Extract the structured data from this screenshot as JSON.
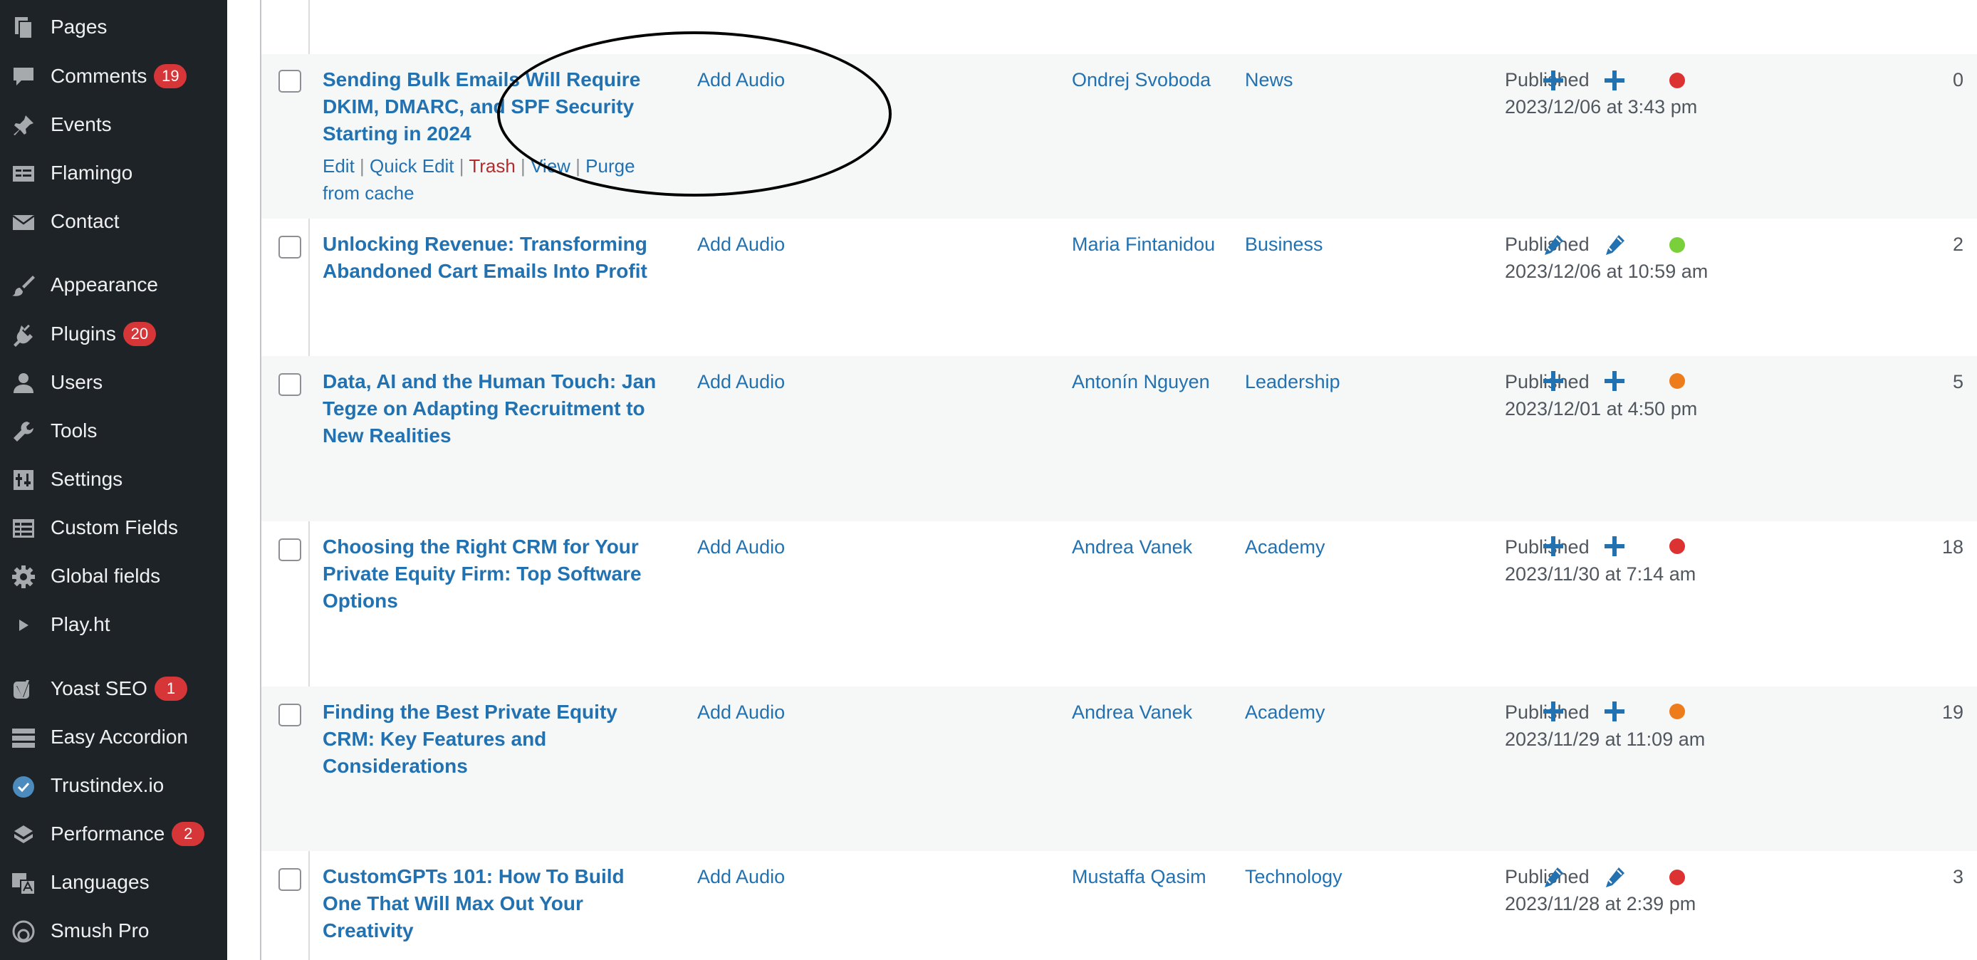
{
  "sidebar": {
    "items": [
      {
        "label": "Pages",
        "icon": "pages-icon",
        "badge": ""
      },
      {
        "label": "Comments",
        "icon": "comments-icon",
        "badge": "19"
      },
      {
        "label": "Events",
        "icon": "events-pin-icon",
        "badge": ""
      },
      {
        "label": "Flamingo",
        "icon": "flamingo-icon",
        "badge": ""
      },
      {
        "label": "Contact",
        "icon": "envelope-icon",
        "badge": ""
      },
      {
        "label": "Appearance",
        "icon": "paintbrush-icon",
        "badge": ""
      },
      {
        "label": "Plugins",
        "icon": "plugin-icon",
        "badge": "20"
      },
      {
        "label": "Users",
        "icon": "users-icon",
        "badge": ""
      },
      {
        "label": "Tools",
        "icon": "wrench-icon",
        "badge": ""
      },
      {
        "label": "Settings",
        "icon": "settings-icon",
        "badge": ""
      },
      {
        "label": "Custom Fields",
        "icon": "custom-fields-icon",
        "badge": ""
      },
      {
        "label": "Global fields",
        "icon": "gear-icon",
        "badge": ""
      },
      {
        "label": "Play.ht",
        "icon": "play-icon",
        "badge": ""
      },
      {
        "label": "Yoast SEO",
        "icon": "yoast-icon",
        "badge": "1"
      },
      {
        "label": "Easy Accordion",
        "icon": "accordion-icon",
        "badge": ""
      },
      {
        "label": "Trustindex.io",
        "icon": "trustindex-check-icon",
        "badge": ""
      },
      {
        "label": "Performance",
        "icon": "performance-icon",
        "badge": "2"
      },
      {
        "label": "Languages",
        "icon": "languages-icon",
        "badge": ""
      },
      {
        "label": "Smush Pro",
        "icon": "smush-icon",
        "badge": ""
      }
    ]
  },
  "posts": {
    "rows": [
      {
        "title": "Sending Bulk Emails Will Require DKIM, DMARC, and SPF Security Starting in 2024",
        "audio": "Add Audio",
        "author": "Ondrej Svoboda",
        "category": "News",
        "status": "Published",
        "date": "2023/12/06 at 3:43 pm",
        "icon1": "plus-icon",
        "icon2": "plus-icon",
        "dot_color": "#dc3232",
        "count": "0",
        "actions": {
          "edit": "Edit",
          "quick_edit": "Quick Edit",
          "trash": "Trash",
          "view": "View",
          "purge": "Purge from cache",
          "sep": "|"
        }
      },
      {
        "title": "Unlocking Revenue: Transforming Abandoned Cart Emails Into Profit",
        "audio": "Add Audio",
        "author": "Maria Fintanidou",
        "category": "Business",
        "status": "Published",
        "date": "2023/12/06 at 10:59 am",
        "icon1": "pencil-icon",
        "icon2": "pencil-icon",
        "dot_color": "#7ad03a",
        "count": "2"
      },
      {
        "title": "Data, AI and the Human Touch: Jan Tegze on Adapting Recruitment to New Realities",
        "audio": "Add Audio",
        "author": "Antonín Nguyen",
        "category": "Leadership",
        "status": "Published",
        "date": "2023/12/01 at 4:50 pm",
        "icon1": "plus-icon",
        "icon2": "plus-icon",
        "dot_color": "#ee7c1b",
        "count": "5"
      },
      {
        "title": "Choosing the Right CRM for Your Private Equity Firm: Top Software Options",
        "audio": "Add Audio",
        "author": "Andrea Vanek",
        "category": "Academy",
        "status": "Published",
        "date": "2023/11/30 at 7:14 am",
        "icon1": "plus-icon",
        "icon2": "plus-icon",
        "dot_color": "#dc3232",
        "count": "18"
      },
      {
        "title": "Finding the Best Private Equity CRM: Key Features and Considerations",
        "audio": "Add Audio",
        "author": "Andrea Vanek",
        "category": "Academy",
        "status": "Published",
        "date": "2023/11/29 at 11:09 am",
        "icon1": "plus-icon",
        "icon2": "plus-icon",
        "dot_color": "#ee7c1b",
        "count": "19"
      },
      {
        "title": "CustomGPTs 101: How To Build One That Will Max Out Your Creativity",
        "audio": "Add Audio",
        "author": "Mustaffa Qasim",
        "category": "Technology",
        "status": "Published",
        "date": "2023/11/28 at 2:39 pm",
        "icon1": "pencil-icon",
        "icon2": "pencil-icon",
        "dot_color": "#dc3232",
        "count": "3"
      }
    ]
  },
  "colors": {
    "sidebar_bg": "#1d2327",
    "link": "#2271b1",
    "badge": "#d63638",
    "trash": "#b32d2e"
  }
}
